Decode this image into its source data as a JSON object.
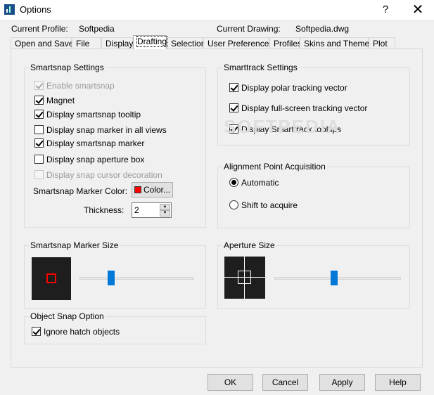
{
  "window": {
    "title": "Options",
    "help": "?",
    "close": "✕"
  },
  "header": {
    "profile_label": "Current Profile:",
    "profile_value": "Softpedia",
    "drawing_label": "Current Drawing:",
    "drawing_value": "Softpedia.dwg"
  },
  "tabs": [
    {
      "label": "Open and Save"
    },
    {
      "label": "File"
    },
    {
      "label": "Display"
    },
    {
      "label": "Drafting",
      "active": true
    },
    {
      "label": "Selection"
    },
    {
      "label": "User Preferences"
    },
    {
      "label": "Profiles"
    },
    {
      "label": "Skins and Themes"
    },
    {
      "label": "Plot"
    }
  ],
  "smartsnap": {
    "title": "Smartsnap Settings",
    "options": [
      {
        "label": "Enable smartsnap",
        "checked": true,
        "disabled": true
      },
      {
        "label": "Magnet",
        "checked": true
      },
      {
        "label": "Display smartsnap tooltip",
        "checked": true
      },
      {
        "label": "Display snap marker in all views",
        "checked": false
      },
      {
        "label": "Display smartsnap marker",
        "checked": true
      },
      {
        "label": "Display snap aperture box",
        "checked": false
      },
      {
        "label": "Display snap cursor decoration",
        "checked": false,
        "disabled": true
      }
    ],
    "color_label": "Smartsnap Marker Color:",
    "color_button": "Color...",
    "color": "#ff0000",
    "thickness_label": "Thickness:",
    "thickness_value": "2"
  },
  "smarttrack": {
    "title": "Smarttrack Settings",
    "options": [
      {
        "label": "Display polar tracking vector",
        "checked": true
      },
      {
        "label": "Display full-screen tracking vector",
        "checked": true
      },
      {
        "label": "Display Smarttrack tooltips",
        "checked": true
      }
    ]
  },
  "alignment": {
    "title": "Alignment Point Acquisition",
    "options": [
      {
        "label": "Automatic",
        "checked": true
      },
      {
        "label": "Shift to acquire",
        "checked": false
      }
    ]
  },
  "marker_size": {
    "title": "Smartsnap Marker Size",
    "value": 0.28
  },
  "aperture_size": {
    "title": "Aperture Size",
    "value": 0.47
  },
  "object_snap": {
    "title": "Object Snap Option",
    "options": [
      {
        "label": "Ignore hatch objects",
        "checked": true
      }
    ]
  },
  "watermark": "SOFTPEDIA",
  "buttons": {
    "ok": "OK",
    "cancel": "Cancel",
    "apply": "Apply",
    "help": "Help"
  },
  "colors": {
    "accent": "#0078d7",
    "preview_bg": "#1e1e1e"
  }
}
